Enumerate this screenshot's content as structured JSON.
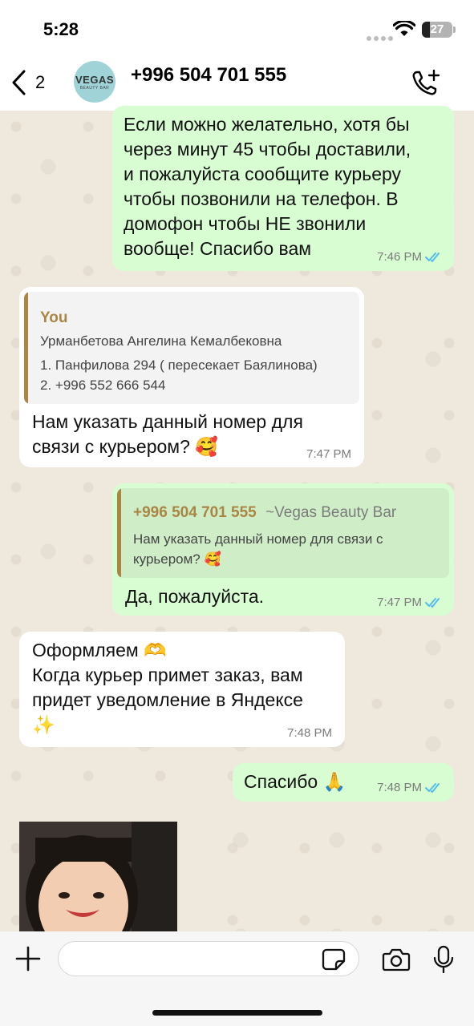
{
  "status_bar": {
    "time": "5:28",
    "battery": "27",
    "battery_level": 0.27
  },
  "header": {
    "back_count": "2",
    "avatar_line1": "VEGAS",
    "avatar_line2": "BEAUTY BAR",
    "contact": "+996 504 701 555"
  },
  "messages": {
    "m1": {
      "lines": [
        "Если можно желательно, хотя бы",
        "через минут 45 чтобы доставили,",
        "и пожалуйста сообщите курьеру",
        "чтобы позвонили на телефон. В",
        "домофон чтобы НЕ звонили",
        "вообще! Спасибо вам"
      ],
      "time": "7:46 PM"
    },
    "m2": {
      "quote_name": "You",
      "quote_lines": [
        "Урманбетова Ангелина Кемалбековна",
        "1. Панфилова 294 ( пересекает Баялинова)",
        "2. +996 552 666 544"
      ],
      "lines": [
        "Нам указать данный номер для",
        "связи с курьером? 🥰"
      ],
      "time": "7:47 PM"
    },
    "m3": {
      "quote_name": "+996 504 701 555",
      "quote_sub": "~Vegas Beauty Bar",
      "quote_lines": [
        "Нам указать данный номер для связи с",
        "курьером? 🥰"
      ],
      "text": "Да, пожалуйста.",
      "time": "7:47 PM"
    },
    "m4": {
      "lines": [
        "Оформляем 🫶",
        "Когда курьер примет заказ, вам",
        "придет уведомление в Яндексе",
        "✨"
      ],
      "time": "7:48 PM"
    },
    "m5": {
      "text": "Спасибо 🙏",
      "time": "7:48 PM"
    }
  },
  "icons": {
    "back": "chevron-left-icon",
    "call_add": "phone-plus-icon",
    "plus": "plus-icon",
    "sticker": "sticker-icon",
    "camera": "camera-icon",
    "mic": "microphone-icon",
    "read_ticks": "double-check-icon"
  },
  "colors": {
    "outgoing": "#d9fdd3",
    "incoming": "#ffffff",
    "ticks": "#53bdeb",
    "quote_accent": "#a98644",
    "quote_bg_out": "#cfeec8",
    "quote_bg_in": "#f3f3f3"
  }
}
